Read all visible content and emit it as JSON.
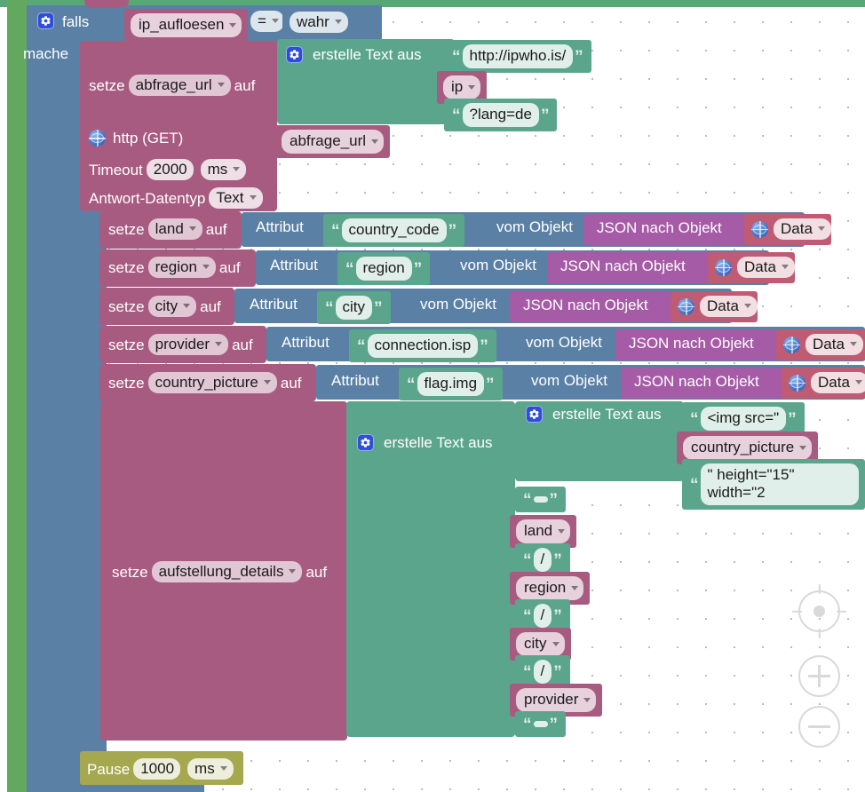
{
  "app": {
    "kind": "blockly-visual-editor",
    "language": "de"
  },
  "colors": {
    "control_blue": "#5b80a5",
    "variable_magenta": "#a85b80",
    "text_green": "#5ba58c",
    "json_purple": "#a55ba5",
    "data_crimson": "#bf5b72",
    "pause_olive": "#a6a84f",
    "rail_green": "#62a85f",
    "top_strip_green": "#58a877",
    "canvas_white": "#ffffff",
    "grid_dot": "#b9b9c4"
  },
  "if_block": {
    "keyword": "falls",
    "do_keyword": "mache",
    "condition": {
      "left_variable": "ip_aufloesen",
      "operator": "=",
      "right_value": "wahr"
    }
  },
  "set_url": {
    "keyword": "setze",
    "variable": "abfrage_url",
    "connector": "auf",
    "value_block": {
      "label": "erstelle Text aus",
      "items": [
        {
          "type": "text",
          "value": "http://ipwho.is/"
        },
        {
          "type": "variable",
          "value": "ip"
        },
        {
          "type": "text",
          "value": "?lang=de"
        }
      ]
    }
  },
  "http_block": {
    "label": "http (GET)",
    "url_variable": "abfrage_url",
    "timeout_label": "Timeout",
    "timeout_value": "2000",
    "timeout_unit": "ms",
    "response_type_label": "Antwort-Datentyp",
    "response_type_value": "Text"
  },
  "assignments": [
    {
      "keyword": "setze",
      "variable": "land",
      "connector": "auf",
      "attribute_label": "Attribut",
      "attribute_name": "country_code",
      "from_label": "vom Objekt",
      "json_label": "JSON nach Objekt",
      "source": "Data"
    },
    {
      "keyword": "setze",
      "variable": "region",
      "connector": "auf",
      "attribute_label": "Attribut",
      "attribute_name": "region",
      "from_label": "vom Objekt",
      "json_label": "JSON nach Objekt",
      "source": "Data"
    },
    {
      "keyword": "setze",
      "variable": "city",
      "connector": "auf",
      "attribute_label": "Attribut",
      "attribute_name": "city",
      "from_label": "vom Objekt",
      "json_label": "JSON nach Objekt",
      "source": "Data"
    },
    {
      "keyword": "setze",
      "variable": "provider",
      "connector": "auf",
      "attribute_label": "Attribut",
      "attribute_name": "connection.isp",
      "from_label": "vom Objekt",
      "json_label": "JSON nach Objekt",
      "source": "Data"
    },
    {
      "keyword": "setze",
      "variable": "country_picture",
      "connector": "auf",
      "attribute_label": "Attribut",
      "attribute_name": "flag.img",
      "from_label": "vom Objekt",
      "json_label": "JSON nach Objekt",
      "source": "Data"
    }
  ],
  "set_details": {
    "keyword": "setze",
    "variable": "aufstellung_details",
    "connector": "auf",
    "outer_text_label": "erstelle Text aus",
    "inner_text_label": "erstelle Text aus",
    "inner_items": [
      {
        "type": "text",
        "value": "<img src=\""
      },
      {
        "type": "variable",
        "value": "country_picture"
      },
      {
        "type": "text",
        "value": "\" height=\"15\" width=\"2"
      }
    ],
    "outer_items": [
      {
        "type": "text",
        "value": " "
      },
      {
        "type": "variable",
        "value": "land"
      },
      {
        "type": "text",
        "value": "/"
      },
      {
        "type": "variable",
        "value": "region"
      },
      {
        "type": "text",
        "value": "/"
      },
      {
        "type": "variable",
        "value": "city"
      },
      {
        "type": "text",
        "value": "/"
      },
      {
        "type": "variable",
        "value": "provider"
      },
      {
        "type": "text",
        "value": " "
      }
    ]
  },
  "pause_block": {
    "label": "Pause",
    "value": "1000",
    "unit": "ms"
  },
  "zoom_controls": {
    "center": "zoom-center",
    "zoom_in": "+",
    "zoom_out": "−"
  }
}
